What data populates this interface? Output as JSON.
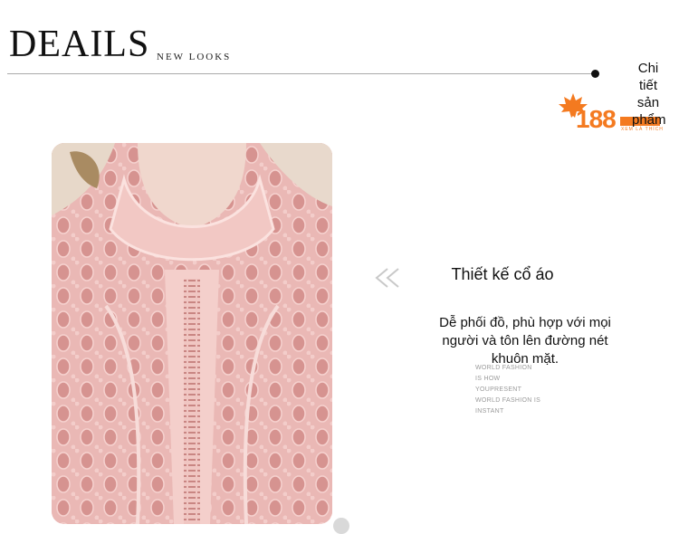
{
  "header": {
    "title": "DEAILS",
    "subtitle": "NEW LOOKS",
    "side_text": "Chi tiết sản phẩm"
  },
  "logo": {
    "text": "188",
    "tagline": "XEM LÀ THÍCH",
    "color": "#f47a20"
  },
  "feature": {
    "title": "Thiết kế cổ áo",
    "description": "Dễ phối đồ, phù hợp với mọi người và tôn lên đường nét khuôn mặt.",
    "small_lines": [
      "WORLD FASHION",
      "IS HOW",
      "YOUPRESENT",
      "WORLD FASHION IS",
      "INSTANT"
    ]
  },
  "photo": {
    "subject": "pink lace blouse with stand-up collar",
    "color": "#e9b7b4"
  },
  "icons": {
    "arrows": "double-left-arrow-icon",
    "logo_leaf": "maple-leaf-icon"
  }
}
